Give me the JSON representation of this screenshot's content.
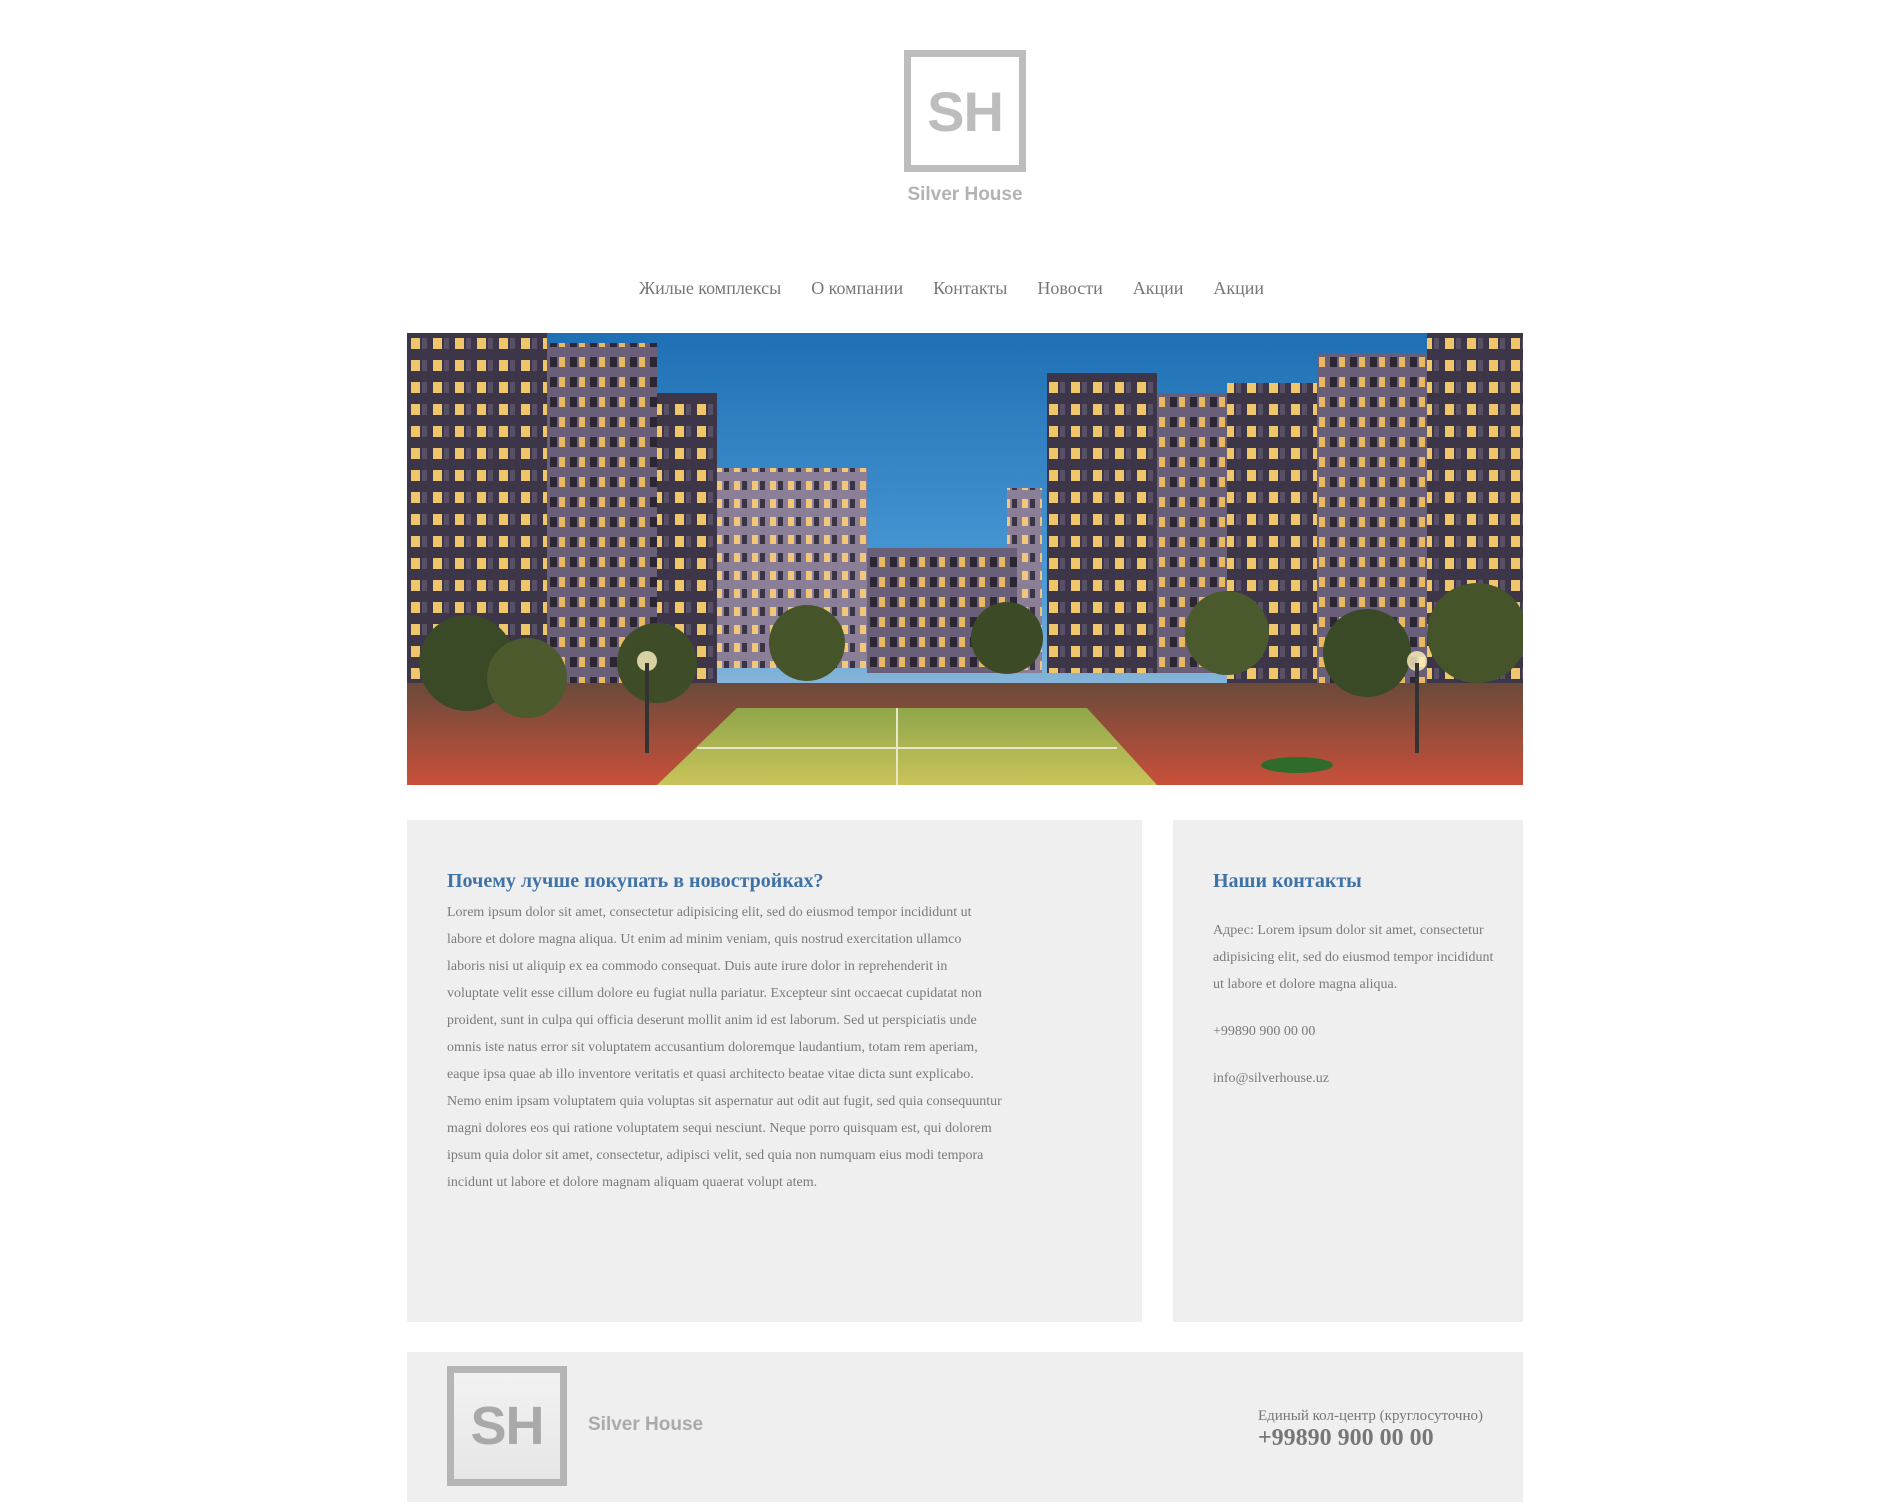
{
  "brand": {
    "letters": "SH",
    "name": "Silver House",
    "logo_color": "#bdbdbd"
  },
  "nav": {
    "items": [
      {
        "label": "Жилые комплексы"
      },
      {
        "label": "О компании"
      },
      {
        "label": "Контакты"
      },
      {
        "label": "Новости"
      },
      {
        "label": "Акции"
      },
      {
        "label": "Акции"
      }
    ]
  },
  "hero": {
    "image": "night-residential-complex-courtyard"
  },
  "article": {
    "title": "Почему лучше покупать в новостройках?",
    "body": "Lorem ipsum dolor sit amet, consectetur adipisicing elit, sed do eiusmod tempor incididunt ut labore et dolore magna aliqua. Ut enim ad minim veniam, quis nostrud exercitation ullamco laboris nisi ut aliquip ex ea commodo consequat. Duis aute irure dolor in reprehenderit in voluptate velit esse cillum dolore eu fugiat nulla pariatur. Excepteur sint occaecat cupidatat non proident, sunt in culpa qui officia deserunt mollit anim id est laborum. Sed ut perspiciatis unde omnis iste natus error sit voluptatem accusantium doloremque laudantium, totam rem aperiam, eaque ipsa quae ab illo inventore veritatis et quasi architecto beatae vitae dicta sunt explicabo. Nemo enim ipsam voluptatem quia voluptas sit aspernatur aut odit aut fugit, sed quia consequuntur magni dolores eos qui ratione voluptatem sequi nesciunt. Neque porro quisquam est, qui dolorem ipsum quia dolor sit amet, consectetur, adipisci velit, sed quia non numquam eius modi tempora incidunt ut labore et dolore magnam aliquam quaerat volupt atem."
  },
  "contacts": {
    "title": "Наши контакты",
    "address": "Адрес: Lorem ipsum dolor sit amet, consectetur adipisicing elit, sed do eiusmod tempor incididunt ut labore et dolore magna aliqua.",
    "phone": "+99890 900 00 00",
    "email": "info@silverhouse.uz"
  },
  "footer": {
    "letters": "SH",
    "name": "Silver House",
    "call_label": "Единый кол-центр (круглосуточно)",
    "call_phone": "+99890 900 00 00"
  },
  "colors": {
    "accent": "#3f73a8",
    "panel": "#efefef",
    "text": "#7a7a7a"
  }
}
